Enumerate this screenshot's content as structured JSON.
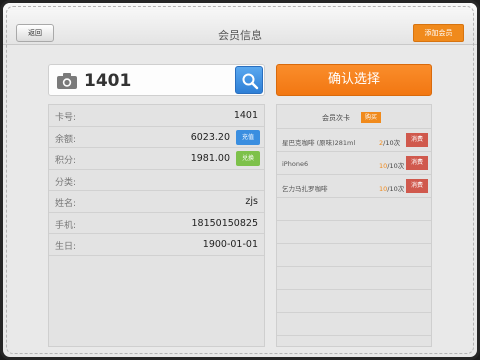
{
  "header": {
    "back_label": "返回",
    "title": "会员信息",
    "add_label": "添加会员"
  },
  "search": {
    "value": "1401",
    "icon": "search-icon",
    "camera_icon": "camera-icon"
  },
  "confirm_label": "确认选择",
  "member": {
    "rows": [
      {
        "label": "卡号:",
        "value": "1401"
      },
      {
        "label": "余额:",
        "value": "6023.20",
        "action": "充值"
      },
      {
        "label": "积分:",
        "value": "1981.00",
        "action": "兑换"
      },
      {
        "label": "分类:",
        "value": ""
      },
      {
        "label": "姓名:",
        "value": "zjs"
      },
      {
        "label": "手机:",
        "value": "18150150825"
      },
      {
        "label": "生日:",
        "value": "1900-01-01"
      }
    ]
  },
  "cards": {
    "title": "会员次卡",
    "buy_label": "购买",
    "items": [
      {
        "name": "星巴克咖啡 (原味)281ml",
        "used": "2",
        "total": "/10次",
        "action": "消费"
      },
      {
        "name": "iPhone6",
        "used": "10",
        "total": "/10次",
        "action": "消费"
      },
      {
        "name": "乞力马扎罗咖啡",
        "used": "10",
        "total": "/10次",
        "action": "消费"
      }
    ]
  },
  "colors": {
    "accent": "#f08a1c",
    "search_button": "#3a8ee0",
    "recharge": "#3a8ee0",
    "redeem": "#7dc14a",
    "consume": "#d0594d"
  }
}
